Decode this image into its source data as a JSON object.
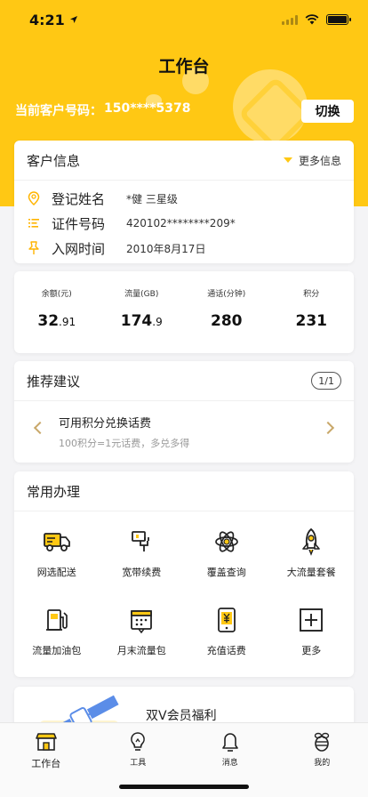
{
  "status": {
    "time": "4:21"
  },
  "header": {
    "title": "工作台"
  },
  "customer": {
    "label": "当前客户号码：",
    "number": "150****5378",
    "switch_label": "切换"
  },
  "info": {
    "title": "客户信息",
    "more_label": "更多信息",
    "rows": [
      {
        "label": "登记姓名",
        "value": "*健 三星级",
        "icon": "user-location-icon"
      },
      {
        "label": "证件号码",
        "value": "420102********209*",
        "icon": "id-list-icon"
      },
      {
        "label": "入网时间",
        "value": "2010年8月17日",
        "icon": "pin-icon"
      }
    ]
  },
  "stats": [
    {
      "label": "余额(元)",
      "int": "32",
      "frac": ".91"
    },
    {
      "label": "流量(GB)",
      "int": "174",
      "frac": ".9"
    },
    {
      "label": "通话(分钟)",
      "int": "280",
      "frac": ""
    },
    {
      "label": "积分",
      "int": "231",
      "frac": ""
    }
  ],
  "recommend": {
    "title": "推荐建议",
    "page": "1/1",
    "item_title": "可用积分兑换话费",
    "item_desc": "100积分=1元话费，多兑多得"
  },
  "services": {
    "title": "常用办理",
    "items": [
      {
        "label": "网选配送",
        "icon": "delivery-truck-icon"
      },
      {
        "label": "宽带续费",
        "icon": "broadband-plug-icon"
      },
      {
        "label": "覆盖查询",
        "icon": "atom-coverage-icon"
      },
      {
        "label": "大流量套餐",
        "icon": "rocket-icon"
      },
      {
        "label": "流量加油包",
        "icon": "fuel-pump-icon"
      },
      {
        "label": "月末流量包",
        "icon": "monthly-calendar-icon"
      },
      {
        "label": "充值话费",
        "icon": "phone-yuan-icon"
      },
      {
        "label": "更多",
        "icon": "plus-box-icon"
      }
    ]
  },
  "vip": {
    "title": "双V会员福利"
  },
  "tabs": [
    {
      "label": "工作台",
      "icon": "shop-icon"
    },
    {
      "label": "工具",
      "icon": "lightbulb-icon"
    },
    {
      "label": "消息",
      "icon": "bell-icon"
    },
    {
      "label": "我的",
      "icon": "bee-icon"
    }
  ],
  "colors": {
    "brand_yellow": "#ffc814",
    "accent_gold": "#c9a86a",
    "background": "#f4f4f6"
  }
}
